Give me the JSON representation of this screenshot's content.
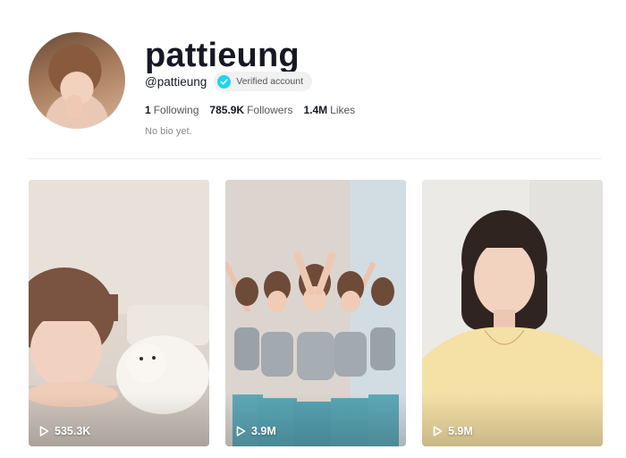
{
  "profile": {
    "username": "pattieung",
    "handle": "@pattieung",
    "verified_label": "Verified account",
    "following_count": "1",
    "following_label": "Following",
    "followers_count": "785.9K",
    "followers_label": "Followers",
    "likes_count": "1.4M",
    "likes_label": "Likes",
    "bio": "No bio yet."
  },
  "videos": [
    {
      "views": "535.3K",
      "icon": "play-icon"
    },
    {
      "views": "3.9M",
      "icon": "play-icon"
    },
    {
      "views": "5.9M",
      "icon": "play-icon"
    }
  ],
  "colors": {
    "verified_badge": "#20d5ec",
    "text_primary": "#161823",
    "text_secondary": "#8a8b91"
  }
}
